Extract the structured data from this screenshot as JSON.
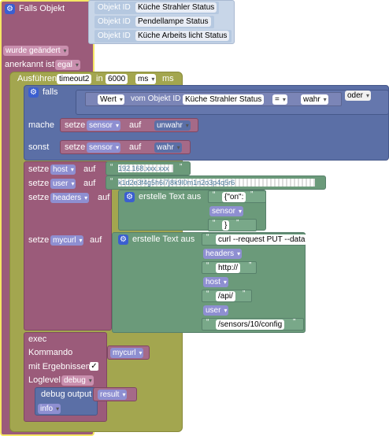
{
  "trigger": {
    "label": "Falls Objekt",
    "objects": [
      {
        "prefix": "Objekt ID",
        "value": "Küche Strahler Status"
      },
      {
        "prefix": "Objekt ID",
        "value": "Pendellampe Status"
      },
      {
        "prefix": "Objekt ID",
        "value": "Küche Arbeits licht Status"
      }
    ],
    "changed": "wurde geändert",
    "acknowledged_label": "anerkannt ist",
    "acknowledged_value": "egal"
  },
  "timeout": {
    "label": "Ausführen",
    "name": "timeout2",
    "in_label": "in",
    "value": "6000",
    "unit_dd": "ms",
    "unit_label": "ms"
  },
  "if_block": {
    "label": "falls",
    "wert": "Wert",
    "vom_label": "vom Objekt ID",
    "object": "Küche Strahler Status",
    "op": "=",
    "value": "wahr",
    "oder": "oder",
    "mache_label": "mache",
    "mache_set": "setze",
    "mache_var": "sensor",
    "mache_auf": "auf",
    "mache_value": "unwahr",
    "sonst_label": "sonst",
    "sonst_set": "setze",
    "sonst_var": "sensor",
    "sonst_auf": "auf",
    "sonst_value": "wahr"
  },
  "setters": {
    "setze": "setze",
    "auf": "auf",
    "host_var": "host",
    "host_value": "192.168.xxx.xxx",
    "user_var": "user",
    "user_value": "k1d2e3f4g5h6i7j8k9l0m1n2o3p4q5r6",
    "headers_var": "headers",
    "headers_label": "erstelle Text aus",
    "headers_items": [
      "{\"on\":",
      "sensor",
      "}"
    ],
    "mycurl_var": "mycurl",
    "mycurl_label": "erstelle Text aus",
    "mycurl_items": [
      "curl --request PUT --data",
      "headers",
      "http://",
      "host",
      "/api/",
      "user",
      "/sensors/10/config"
    ]
  },
  "exec": {
    "label": "exec",
    "kommando_label": "Kommando",
    "kommando_value": "mycurl",
    "ergebnis_label": "mit Ergebnissen",
    "ergebnis_check": "✓",
    "loglevel_label": "Loglevel",
    "loglevel_value": "debug",
    "debug_label": "debug output",
    "debug_value": "result",
    "debug_level": "info"
  },
  "colors": {
    "maroon": "#9b5b7a",
    "olive": "#a3a64f",
    "blue": "#5b6fa6",
    "green": "#6b9a7a"
  }
}
